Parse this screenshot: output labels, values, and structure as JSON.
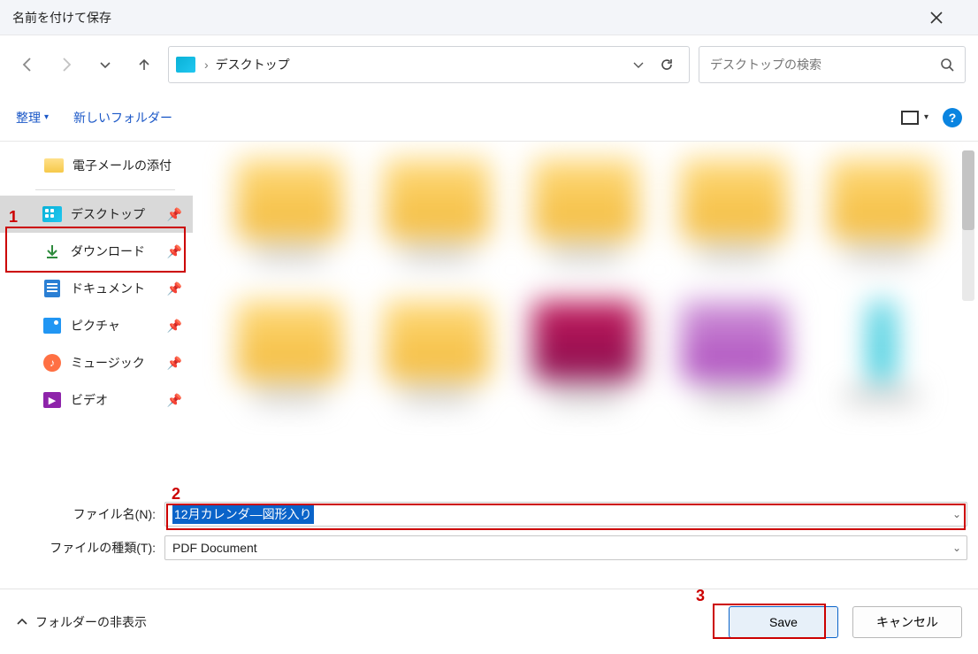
{
  "dialog_title": "名前を付けて保存",
  "breadcrumb": {
    "current": "デスクトップ"
  },
  "search": {
    "placeholder": "デスクトップの検索"
  },
  "toolbar": {
    "organize": "整理",
    "new_folder": "新しいフォルダー"
  },
  "sidebar": {
    "top_item": "電子メールの添付",
    "items": [
      {
        "label": "デスクトップ",
        "icon": "desktop",
        "selected": true
      },
      {
        "label": "ダウンロード",
        "icon": "download"
      },
      {
        "label": "ドキュメント",
        "icon": "document"
      },
      {
        "label": "ピクチャ",
        "icon": "picture"
      },
      {
        "label": "ミュージック",
        "icon": "music"
      },
      {
        "label": "ビデオ",
        "icon": "video"
      }
    ]
  },
  "form": {
    "filename_label": "ファイル名(N):",
    "filename_value": "12月カレンダ―図形入り",
    "filetype_label": "ファイルの種類(T):",
    "filetype_value": "PDF Document"
  },
  "footer": {
    "hide_folders": "フォルダーの非表示",
    "save": "Save",
    "cancel": "キャンセル"
  },
  "annotations": {
    "n1": "1",
    "n2": "2",
    "n3": "3"
  }
}
